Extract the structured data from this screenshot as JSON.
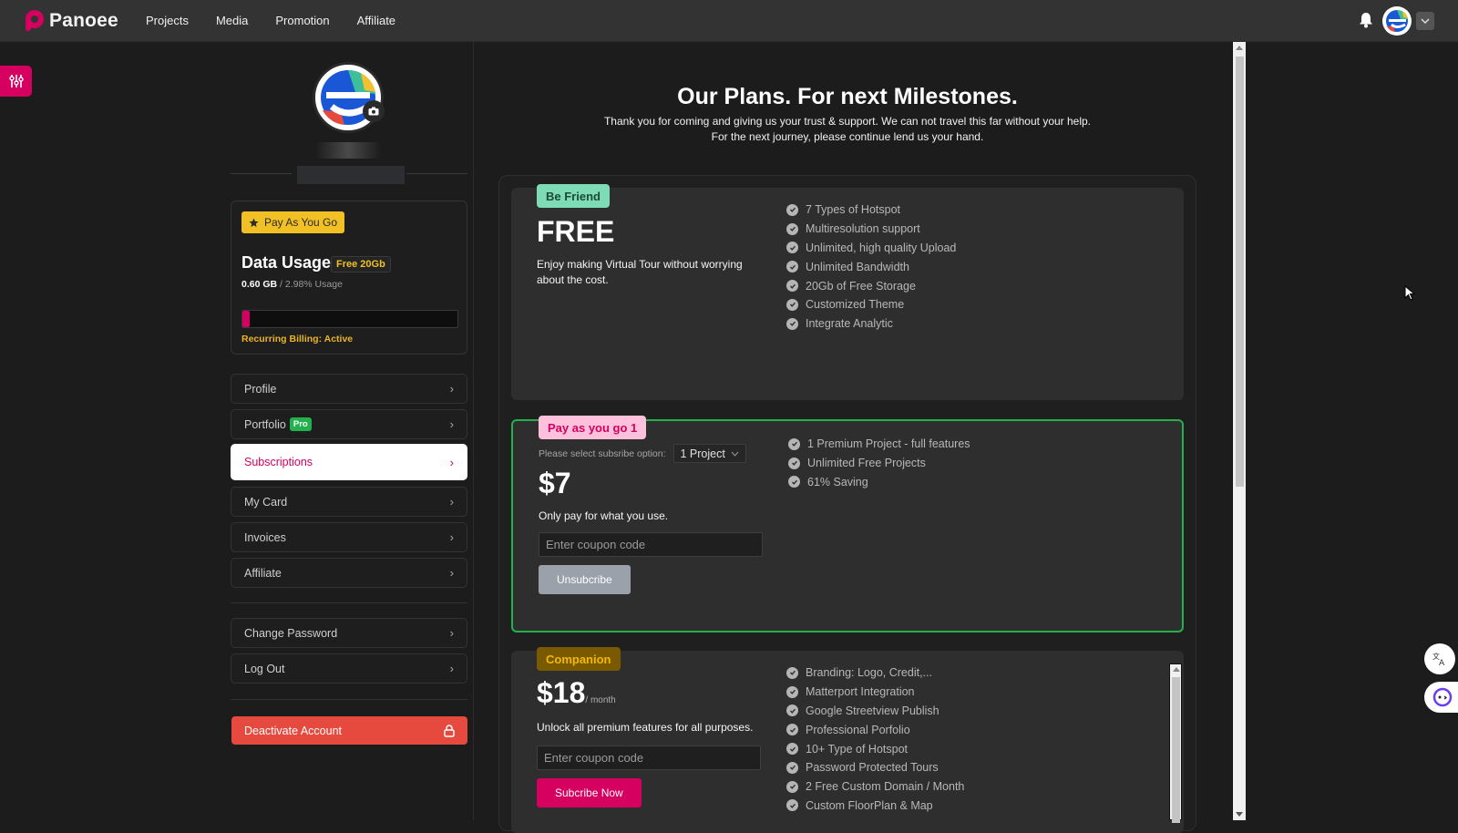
{
  "app": {
    "brand": "Panoee",
    "brand_color": "#d5005f",
    "nav": [
      "Projects",
      "Media",
      "Promotion",
      "Affiliate"
    ]
  },
  "sidebar": {
    "plan_badge": "Pay As You Go",
    "usage_title": "Data Usage",
    "usage_quota_badge": "Free 20Gb",
    "usage_used": "0.60 GB",
    "usage_percent_text": "/ 2.98% Usage",
    "usage_fraction": 0.0298,
    "billing_label": "Recurring Billing:",
    "billing_status": "Active",
    "menu": [
      {
        "label": "Profile"
      },
      {
        "label": "Portfolio",
        "badge": "Pro"
      },
      {
        "label": "Subscriptions",
        "active": true
      },
      {
        "label": "My Card"
      },
      {
        "label": "Invoices"
      },
      {
        "label": "Affiliate"
      }
    ],
    "account_menu": [
      {
        "label": "Change Password"
      },
      {
        "label": "Log Out"
      }
    ],
    "deactivate_label": "Deactivate Account"
  },
  "main": {
    "title": "Our Plans. For next Milestones.",
    "subtitle_line1": "Thank you for coming and giving us your trust & support. We can not travel this far without your help.",
    "subtitle_line2": "For the next journey, please continue lend us your hand.",
    "plans": [
      {
        "tag": "Be Friend",
        "tag_bg": "#7ddbb5",
        "tag_fg": "#1d4a36",
        "price": "FREE",
        "description": "Enjoy making Virtual Tour without worrying about the cost.",
        "features": [
          "7 Types of Hotspot",
          "Multiresolution support",
          "Unlimited, high quality Upload",
          "Unlimited Bandwidth",
          "20Gb of Free Storage",
          "Customized Theme",
          "Integrate Analytic"
        ]
      },
      {
        "tag": "Pay as you go 1",
        "tag_bg": "#ffc0db",
        "tag_fg": "#d5005f",
        "select_label": "Please select subsribe option:",
        "select_value": "1 Project",
        "price": "$7",
        "description": "Only pay for what you use.",
        "coupon_placeholder": "Enter coupon code",
        "button": "Unsubcribe",
        "features": [
          "1 Premium Project - full features",
          "Unlimited Free Projects",
          "61% Saving"
        ]
      },
      {
        "tag": "Companion",
        "tag_bg": "#7a5a00",
        "tag_fg": "#f5b800",
        "price": "$18",
        "price_suffix": "/ month",
        "description": "Unlock all premium features for all purposes.",
        "coupon_placeholder": "Enter coupon code",
        "button": "Subcribe Now",
        "features": [
          "Branding: Logo, Credit,...",
          "Matterport Integration",
          "Google Streetview Publish",
          "Professional Porfolio",
          "10+ Type of Hotspot",
          "Password Protected Tours",
          "2 Free Custom Domain / Month",
          "Custom FloorPlan & Map"
        ]
      }
    ]
  }
}
